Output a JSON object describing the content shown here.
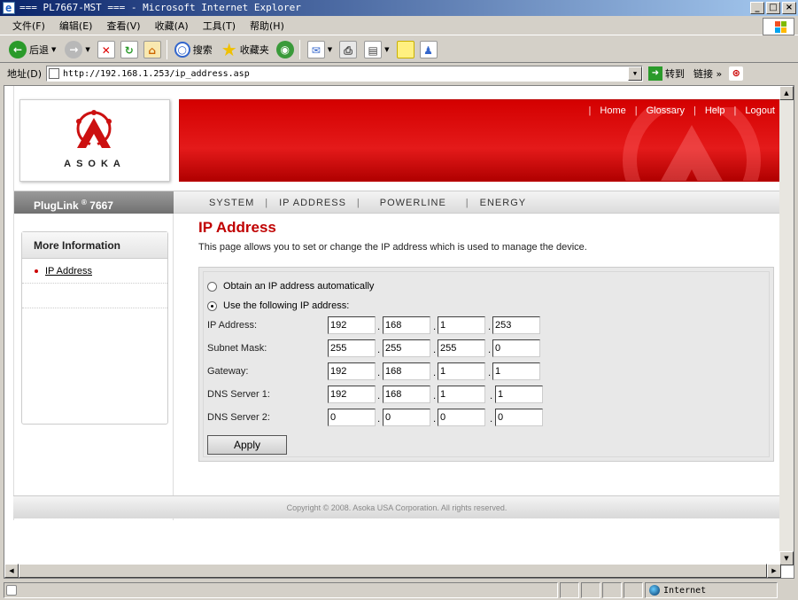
{
  "window": {
    "title": "=== PL7667-MST === - Microsoft Internet Explorer",
    "buttons": [
      "_",
      "□",
      "×"
    ]
  },
  "menubar": {
    "items": [
      "文件(F)",
      "编辑(E)",
      "查看(V)",
      "收藏(A)",
      "工具(T)",
      "帮助(H)"
    ]
  },
  "toolbar": {
    "back_label": "后退",
    "search_label": "搜索",
    "favorites_label": "收藏夹"
  },
  "addressbar": {
    "label": "地址(D)",
    "url": "http://192.168.1.253/ip_address.asp",
    "go_label": "转到",
    "links_label": "链接 »"
  },
  "page": {
    "logo_text": "ASOKA",
    "top_links": [
      "Home",
      "Glossary",
      "Help",
      "Logout"
    ],
    "brand": "PlugLink",
    "brand_sup": "®",
    "brand_model": "7667",
    "nav": [
      "SYSTEM",
      "IP ADDRESS",
      "POWERLINE",
      "ENERGY"
    ],
    "sidebar": {
      "title": "More Information",
      "items": [
        "IP Address"
      ]
    },
    "heading": "IP Address",
    "description": "This page allows you to set or change the IP address which is used to manage the device.",
    "form": {
      "option_auto": "Obtain an IP address automatically",
      "option_manual": "Use the following IP address:",
      "selected": "manual",
      "fields": [
        {
          "label": "IP Address:",
          "octets": [
            "192",
            "168",
            "1",
            "253"
          ]
        },
        {
          "label": "Subnet Mask:",
          "octets": [
            "255",
            "255",
            "255",
            "0"
          ]
        },
        {
          "label": "Gateway:",
          "octets": [
            "192",
            "168",
            "1",
            "1"
          ]
        },
        {
          "label": "DNS Server 1:",
          "octets": [
            "192",
            "168",
            "1",
            "1"
          ]
        },
        {
          "label": "DNS Server 2:",
          "octets": [
            "0",
            "0",
            "0",
            "0"
          ]
        }
      ],
      "apply_label": "Apply"
    },
    "footer": "Copyright © 2008. Asoka USA Corporation. All rights reserved."
  },
  "statusbar": {
    "zone": "Internet"
  },
  "colors": {
    "accent_red": "#c00000",
    "banner_red": "#d40000",
    "titlebar_blue": "#0a246a"
  }
}
